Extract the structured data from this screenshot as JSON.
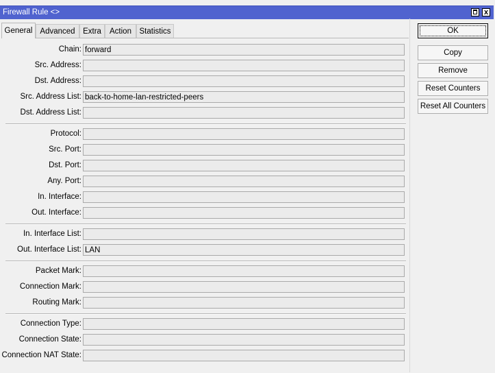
{
  "window": {
    "title": "Firewall Rule <>",
    "close_label": "x"
  },
  "tabs": [
    {
      "label": "General",
      "active": true
    },
    {
      "label": "Advanced",
      "active": false
    },
    {
      "label": "Extra",
      "active": false
    },
    {
      "label": "Action",
      "active": false
    },
    {
      "label": "Statistics",
      "active": false
    }
  ],
  "fields": {
    "chain": {
      "label": "Chain:",
      "value": "forward"
    },
    "src_address": {
      "label": "Src. Address:",
      "value": ""
    },
    "dst_address": {
      "label": "Dst. Address:",
      "value": ""
    },
    "src_address_list": {
      "label": "Src. Address List:",
      "value": "back-to-home-lan-restricted-peers"
    },
    "dst_address_list": {
      "label": "Dst. Address List:",
      "value": ""
    },
    "protocol": {
      "label": "Protocol:",
      "value": ""
    },
    "src_port": {
      "label": "Src. Port:",
      "value": ""
    },
    "dst_port": {
      "label": "Dst. Port:",
      "value": ""
    },
    "any_port": {
      "label": "Any. Port:",
      "value": ""
    },
    "in_interface": {
      "label": "In. Interface:",
      "value": ""
    },
    "out_interface": {
      "label": "Out. Interface:",
      "value": ""
    },
    "in_interface_list": {
      "label": "In. Interface List:",
      "value": ""
    },
    "out_interface_list": {
      "label": "Out. Interface List:",
      "value": "LAN"
    },
    "packet_mark": {
      "label": "Packet Mark:",
      "value": ""
    },
    "connection_mark": {
      "label": "Connection Mark:",
      "value": ""
    },
    "routing_mark": {
      "label": "Routing Mark:",
      "value": ""
    },
    "connection_type": {
      "label": "Connection Type:",
      "value": ""
    },
    "connection_state": {
      "label": "Connection State:",
      "value": ""
    },
    "connection_nat_state": {
      "label": "Connection NAT State:",
      "value": ""
    }
  },
  "buttons": {
    "ok": "OK",
    "copy": "Copy",
    "remove": "Remove",
    "reset_counters": "Reset Counters",
    "reset_all_counters": "Reset All Counters"
  },
  "colors": {
    "titlebar": "#5063cf",
    "background": "#f0f0f0",
    "field_bg": "#ebebeb"
  }
}
